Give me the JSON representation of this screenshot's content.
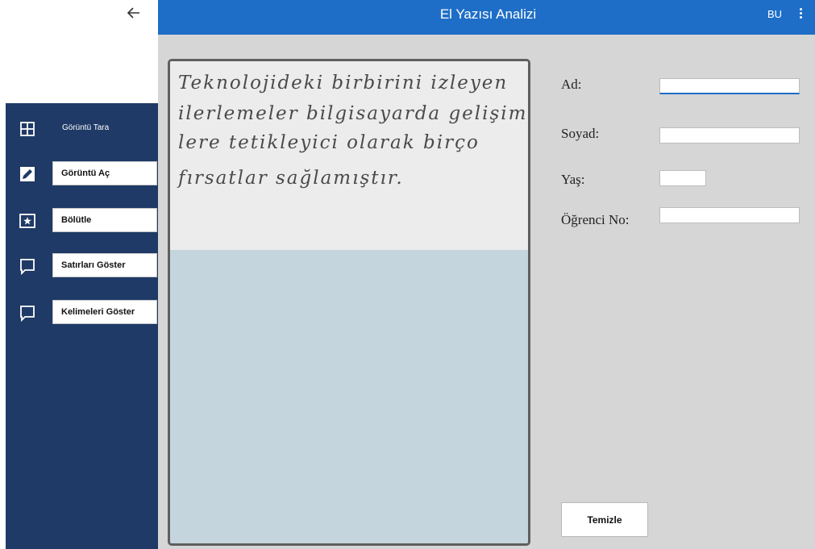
{
  "window": {
    "title": "El Yazısı Analizi",
    "user_initials": "BU"
  },
  "sidebar": {
    "items": [
      {
        "label": "Görüntü Tara",
        "icon": "grid-icon",
        "style": "text"
      },
      {
        "label": "Görüntü Aç",
        "icon": "pencil-icon",
        "style": "button"
      },
      {
        "label": "Bölütle",
        "icon": "star-box-icon",
        "style": "button"
      },
      {
        "label": "Satırları Göster",
        "icon": "comment-icon",
        "style": "button"
      },
      {
        "label": "Kelimeleri Göster",
        "icon": "comment-icon",
        "style": "button"
      }
    ]
  },
  "image": {
    "handwriting_lines": [
      "Teknolojideki birbirini izleyen",
      "ilerlemeler bilgisayarda gelişim-",
      "lere tetikleyici olarak birço",
      "fırsatlar sağlamıştır."
    ]
  },
  "form": {
    "first_name_label": "Ad:",
    "first_name_value": "",
    "last_name_label": "Soyad:",
    "last_name_value": "",
    "age_label": "Yaş:",
    "age_value": "",
    "student_no_label": "Öğrenci No:",
    "student_no_value": "",
    "clear_label": "Temizle"
  },
  "colors": {
    "titlebar": "#1e6ec7",
    "sidebar": "#1f3a66",
    "main_bg": "#d6d6d6"
  }
}
